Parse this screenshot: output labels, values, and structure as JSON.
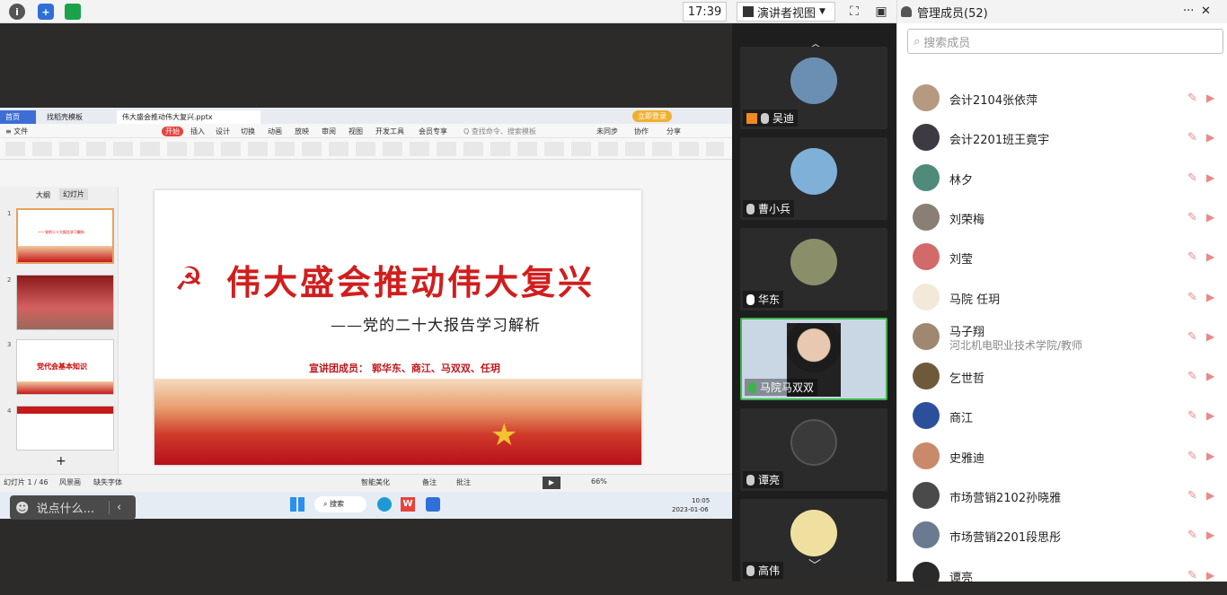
{
  "topbar": {
    "time": "17:39",
    "presenter_view": "演讲者视图",
    "dropdown": "▼"
  },
  "wps": {
    "tabs": [
      "首页",
      "找稻壳模板",
      "伟大盛会推动伟大复兴.pptx"
    ],
    "login": "立即登录",
    "menu": [
      "≡ 文件",
      "开始",
      "插入",
      "设计",
      "切换",
      "动画",
      "放映",
      "审阅",
      "视图",
      "开发工具",
      "会员专享",
      "Q 查找命令、搜索模板"
    ],
    "right_menu": [
      "未同步",
      "协作",
      "分享"
    ],
    "panel_tabs": [
      "大纲",
      "幻灯片"
    ],
    "status": [
      "幻灯片 1 / 46",
      "风景画",
      "缺失字体",
      "智能美化",
      "备注",
      "批注",
      "66%"
    ]
  },
  "slide": {
    "title": "伟大盛会推动伟大复兴",
    "subtitle": "——党的二十大报告学习解析",
    "team": "宣讲团成员： 郭华东、商江、马双双、任玥"
  },
  "thumbs": [
    {
      "n": "1",
      "text": "——党的二十大报告学习解析"
    },
    {
      "n": "2",
      "text": ""
    },
    {
      "n": "3",
      "text": "党代会基本知识"
    },
    {
      "n": "4",
      "text": ""
    }
  ],
  "taskbar": {
    "search": "搜索",
    "date": "2023-01-06",
    "time": "10:05"
  },
  "chat": {
    "placeholder": "说点什么..."
  },
  "videos": [
    {
      "name": "吴迪",
      "color": "#6a8fb3"
    },
    {
      "name": "曹小兵",
      "color": "#7fb0d8"
    },
    {
      "name": "华东",
      "color": "#8a8f6a"
    },
    {
      "name": "马院马双双",
      "color": "#c9d6e4"
    },
    {
      "name": "谭亮",
      "color": "#3a3a3a"
    },
    {
      "name": "高伟",
      "color": "#f0e0a0"
    }
  ],
  "panel": {
    "title": "管理成员(52)",
    "more": "···",
    "close": "✕",
    "search_placeholder": "搜索成员",
    "members": [
      {
        "name": "会计2104张依萍",
        "sub": "",
        "color": "#b59a80"
      },
      {
        "name": "会计2201班王竟宇",
        "sub": "",
        "color": "#3d3a44"
      },
      {
        "name": "林夕",
        "sub": "",
        "color": "#4f8a7a"
      },
      {
        "name": "刘荣梅",
        "sub": "",
        "color": "#8a7f74"
      },
      {
        "name": "刘莹",
        "sub": "",
        "color": "#d26a6a"
      },
      {
        "name": "马院 任玥",
        "sub": "",
        "color": "#f3e9da"
      },
      {
        "name": "马子翔",
        "sub": "河北机电职业技术学院/教师",
        "color": "#a08770"
      },
      {
        "name": "乞世哲",
        "sub": "",
        "color": "#6e5a3a"
      },
      {
        "name": "商江",
        "sub": "",
        "color": "#2c4f9c"
      },
      {
        "name": "史雅迪",
        "sub": "",
        "color": "#c88a6a"
      },
      {
        "name": "市场营销2102孙晓雅",
        "sub": "",
        "color": "#4a4a4a"
      },
      {
        "name": "市场营销2201段思彤",
        "sub": "",
        "color": "#6a7a90"
      },
      {
        "name": "谭亮",
        "sub": "",
        "color": "#2a2a2a"
      }
    ]
  }
}
